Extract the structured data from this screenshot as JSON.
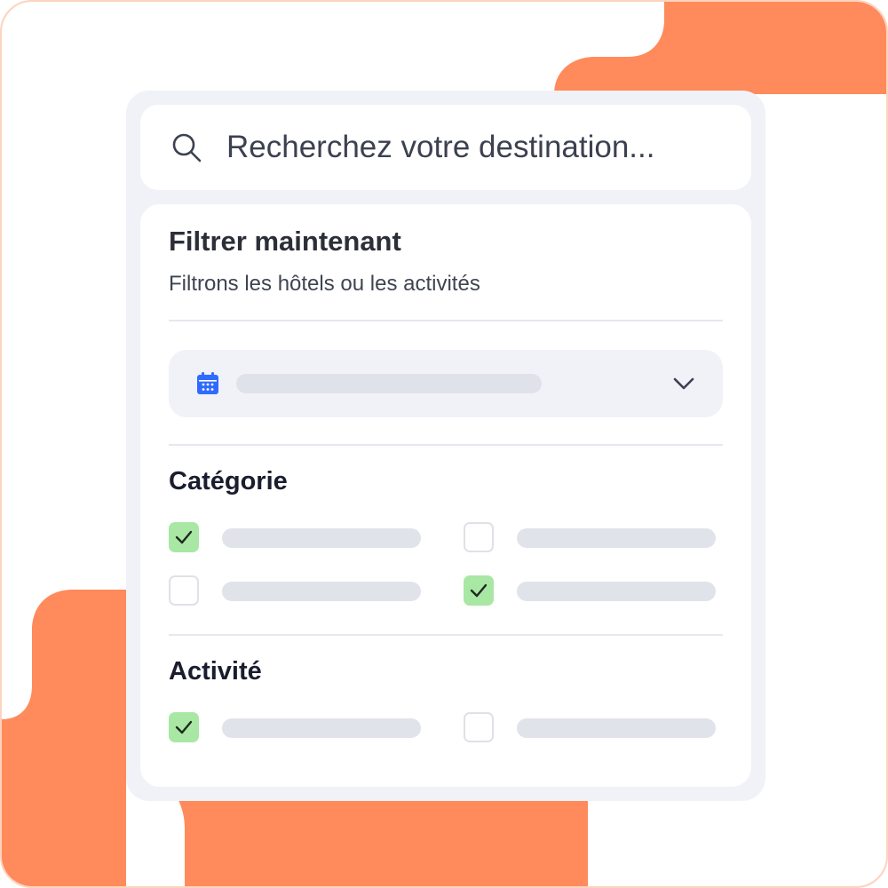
{
  "search": {
    "placeholder": "Recherchez votre destination...",
    "icon": "search-icon"
  },
  "filter": {
    "title": "Filtrer maintenant",
    "subtitle": "Filtrons les hôtels ou les activités"
  },
  "date_select": {
    "icon": "calendar-icon",
    "expand_icon": "chevron-down-icon"
  },
  "categorie": {
    "title": "Catégorie",
    "options": [
      {
        "checked": true
      },
      {
        "checked": false
      },
      {
        "checked": false
      },
      {
        "checked": true
      }
    ]
  },
  "activite": {
    "title": "Activité",
    "options": [
      {
        "checked": true
      },
      {
        "checked": false
      }
    ]
  },
  "colors": {
    "accent": "#ff8a5b",
    "checkbox_checked": "#a8e8a4",
    "calendar_icon": "#2f6bff",
    "panel": "#f1f2f8"
  }
}
